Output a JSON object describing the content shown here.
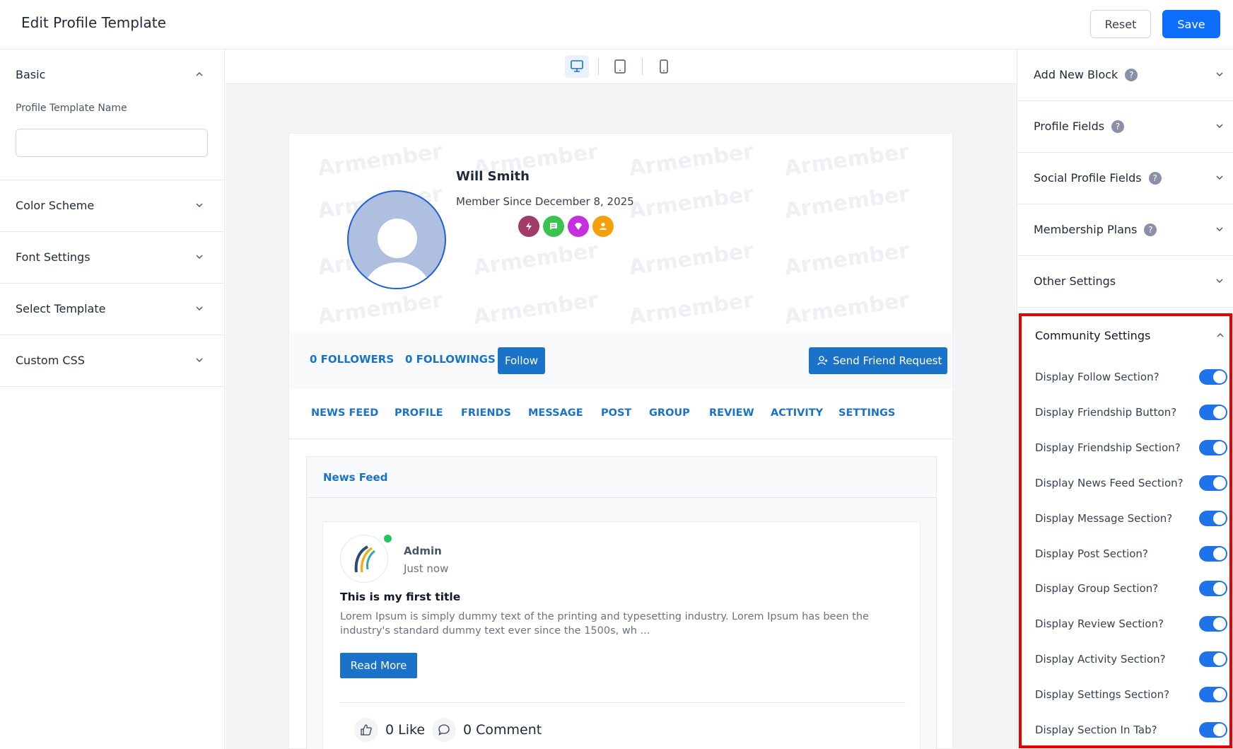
{
  "header": {
    "title": "Edit Profile Template",
    "reset_label": "Reset",
    "save_label": "Save"
  },
  "left_panel": {
    "basic": {
      "title": "Basic",
      "field_label": "Profile Template Name",
      "field_value": ""
    },
    "sections": [
      "Color Scheme",
      "Font Settings",
      "Select Template",
      "Custom CSS"
    ]
  },
  "right_panel": {
    "sections": [
      {
        "title": "Add New Block",
        "help": "?"
      },
      {
        "title": "Profile Fields",
        "help": "?"
      },
      {
        "title": "Social Profile Fields",
        "help": "?"
      },
      {
        "title": "Membership Plans",
        "help": "?"
      },
      {
        "title": "Other Settings"
      }
    ],
    "community": {
      "title": "Community Settings",
      "toggles": [
        {
          "label": "Display Follow Section?",
          "on": true
        },
        {
          "label": "Display Friendship Button?",
          "on": true
        },
        {
          "label": "Display Friendship Section?",
          "on": true
        },
        {
          "label": "Display News Feed Section?",
          "on": true
        },
        {
          "label": "Display Message Section?",
          "on": true
        },
        {
          "label": "Display Post Section?",
          "on": true
        },
        {
          "label": "Display Group Section?",
          "on": true
        },
        {
          "label": "Display Review Section?",
          "on": true
        },
        {
          "label": "Display Activity Section?",
          "on": true
        },
        {
          "label": "Display Settings Section?",
          "on": true
        },
        {
          "label": "Display Section In Tab?",
          "on": true
        }
      ]
    }
  },
  "preview": {
    "devices": [
      "desktop-icon",
      "tablet-icon",
      "mobile-icon"
    ],
    "active_device": "desktop",
    "watermark": "Armember",
    "user": {
      "name": "Will Smith",
      "member_since": "Member Since December 8, 2025"
    },
    "badges": [
      {
        "icon": "bolt-icon",
        "color": "#a23b6a"
      },
      {
        "icon": "chat-icon",
        "color": "#3ac34f"
      },
      {
        "icon": "diamond-icon",
        "color": "#c62fe0"
      },
      {
        "icon": "user-icon",
        "color": "#f59f0b"
      }
    ],
    "followers": "0 FOLLOWERS",
    "followings": "0 FOLLOWINGS",
    "follow_label": "Follow",
    "friend_request_label": "Send Friend Request",
    "tabs": [
      "NEWS FEED",
      "PROFILE",
      "FRIENDS",
      "MESSAGE",
      "POST",
      "GROUP",
      "REVIEW",
      "ACTIVITY",
      "SETTINGS"
    ],
    "feed": {
      "title": "News Feed",
      "post": {
        "author": "Admin",
        "time": "Just now",
        "title": "This is my first title",
        "text": "Lorem Ipsum is simply dummy text of the printing and typesetting industry. Lorem Ipsum has been the industry's standard dummy text ever since the 1500s, wh ...",
        "read_more": "Read More",
        "likes": "0 Like",
        "comments": "0 Comment"
      }
    }
  },
  "colors": {
    "primary": "#0d6efd",
    "link_blue": "#1a73c9",
    "highlight": "#e60000",
    "toggle_on": "#1e73e8"
  }
}
